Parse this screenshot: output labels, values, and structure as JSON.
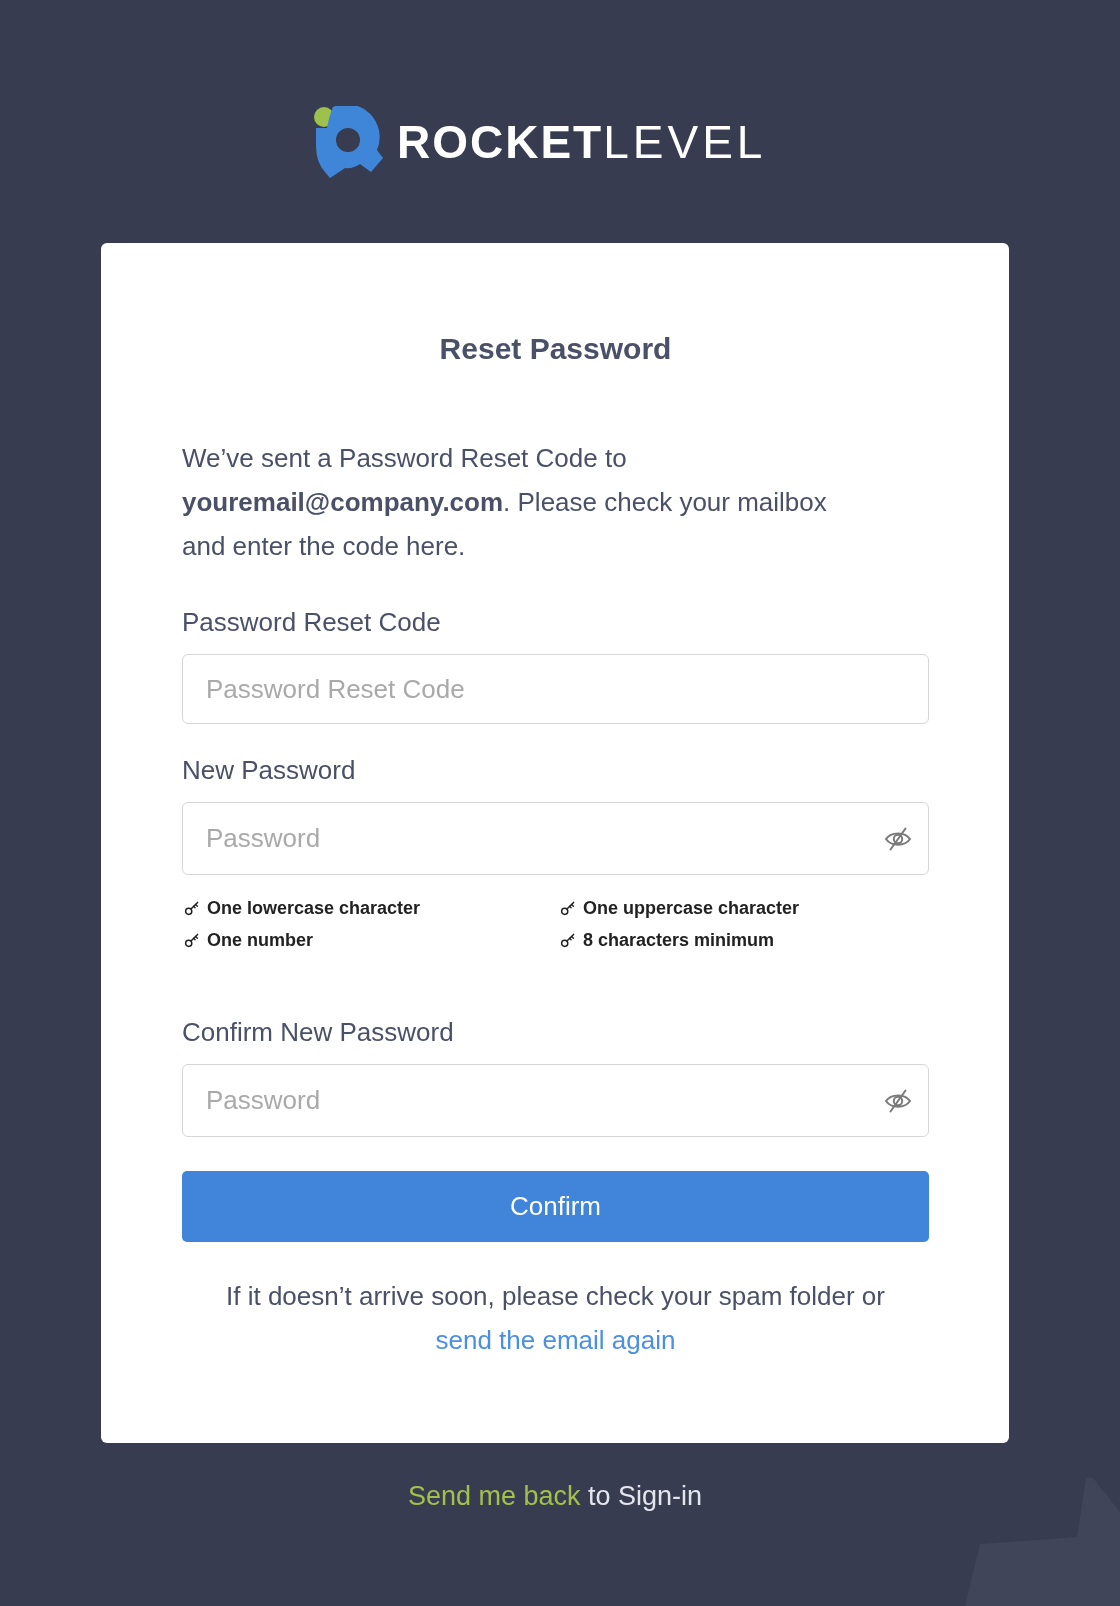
{
  "logo": {
    "bold_part": "ROCKET",
    "light_part": "LEVEL"
  },
  "card": {
    "title": "Reset Password",
    "message": "We’ve sent a Password Reset Code to **youremail@company.com**. Please check your mailbox and enter the code here.",
    "fields": [
      {
        "kind": "text",
        "label": "Password Reset Code",
        "placeholder": "Password Reset Code"
      },
      {
        "kind": "password",
        "label": "New Password",
        "placeholder": "Password",
        "requirements": [
          "One lowercase character",
          "One uppercase character",
          "One number",
          "8 characters minimum"
        ]
      },
      {
        "kind": "password",
        "label": "Confirm New Password",
        "placeholder": "Password"
      }
    ],
    "button": "Confirm",
    "footer_text": "If it doesn’t arrive soon, please check your spam folder or",
    "footer_link": "send the email again"
  },
  "back": {
    "link": "Send me back",
    "text": "to Sign-in"
  }
}
